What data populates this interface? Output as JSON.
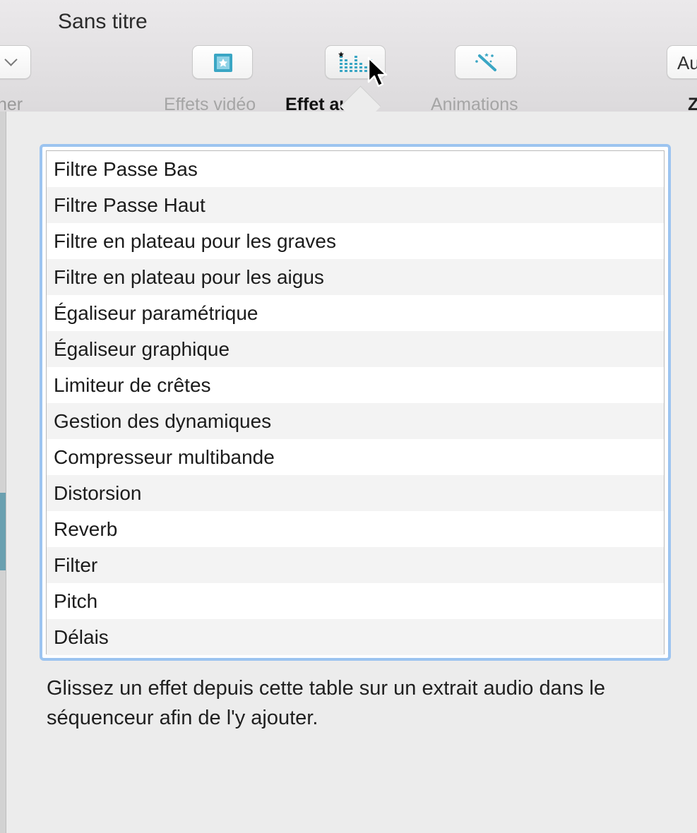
{
  "window": {
    "title": "Sans titre"
  },
  "toolbar": {
    "left_label_partial": "ner",
    "right_button_partial": "Au",
    "right_label_partial": "Z",
    "items": [
      {
        "label": "Effets vidéo",
        "icon": "video-effects-icon"
      },
      {
        "label": "Effet audio",
        "icon": "audio-equalizer-icon",
        "active": true
      },
      {
        "label": "Animations",
        "icon": "magic-wand-icon"
      }
    ]
  },
  "effects_table": {
    "rows": [
      "Filtre Passe Bas",
      "Filtre Passe Haut",
      "Filtre en plateau pour les graves",
      "Filtre en plateau pour les aigus",
      "Égaliseur paramétrique",
      "Égaliseur graphique",
      "Limiteur de crêtes",
      "Gestion des dynamiques",
      "Compresseur multibande",
      "Distorsion",
      "Reverb",
      "Filter",
      "Pitch",
      "Délais"
    ]
  },
  "help_text": "Glissez un effet depuis cette table sur un extrait audio dans le séquenceur afin de l'y ajouter.",
  "colors": {
    "accent_focus": "#9cc4f0",
    "icon_teal": "#3aa6c4"
  }
}
